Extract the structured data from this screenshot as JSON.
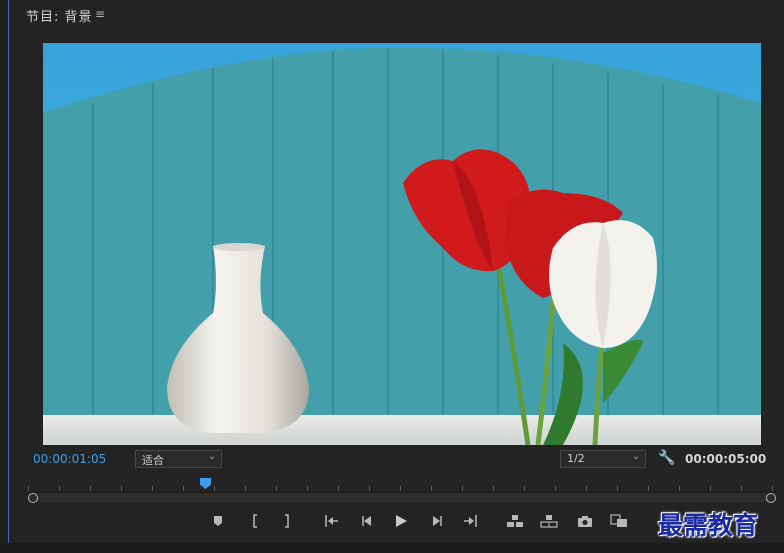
{
  "header": {
    "title": "节目: 背景",
    "menu_icon": "hamburger-menu-icon"
  },
  "info": {
    "current_timecode": "00:00:01:05",
    "zoom_select": "适合",
    "resolution_select": "1/2",
    "duration_timecode": "00:00:05:00"
  },
  "colors": {
    "accent": "#3f9ee9",
    "panel_bg": "#232323",
    "sky": "#2aa9d9",
    "wood": "#3fa0ad"
  },
  "controls": {
    "icons": [
      "add-marker-icon",
      "mark-in-icon",
      "mark-out-icon",
      "go-to-in-icon",
      "step-back-icon",
      "play-icon",
      "step-forward-icon",
      "go-to-out-icon",
      "lift-icon",
      "extract-icon",
      "export-frame-icon",
      "compare-view-icon"
    ]
  },
  "watermark": {
    "text": "最需教育"
  }
}
